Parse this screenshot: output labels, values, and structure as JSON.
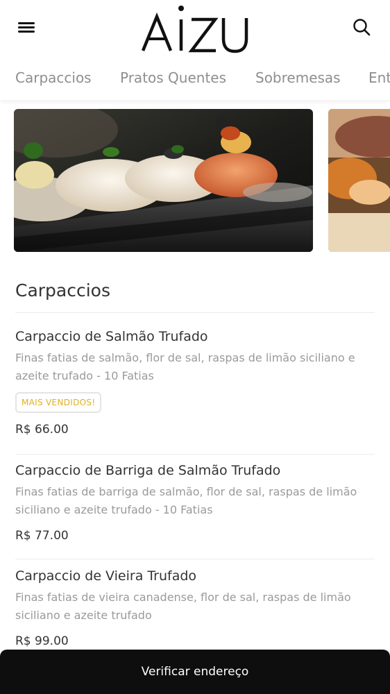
{
  "header": {
    "brand": "AIZU",
    "menu_icon": "hamburger-menu-icon",
    "search_icon": "search-icon"
  },
  "tabs": [
    {
      "label": "Carpaccios"
    },
    {
      "label": "Pratos Quentes"
    },
    {
      "label": "Sobremesas"
    },
    {
      "label": "Ent"
    }
  ],
  "section": {
    "title": "Carpaccios"
  },
  "items": [
    {
      "name": "Carpaccio de Salmão Trufado",
      "desc_line1": "Finas fatias de salmão, flor de sal, raspas de limão siciliano e",
      "desc_line2": "azeite trufado - 10 Fatias",
      "badge": "MAIS VENDIDOS!",
      "price": "R$ 66.00"
    },
    {
      "name": "Carpaccio de Barriga de Salmão Trufado",
      "desc_line1": "Finas fatias de barriga de salmão, flor de sal, raspas de limão",
      "desc_line2": "siciliano e azeite trufado - 10 Fatias",
      "price": "R$ 77.00"
    },
    {
      "name": "Carpaccio de Vieira Trufado",
      "desc_line1": "Finas fatias de vieira canadense, flor de sal, raspas de limão",
      "desc_line2": "siciliano e azeite trufado",
      "price": "R$ 99.00"
    }
  ],
  "bottom_bar": {
    "label": "Verificar endereço"
  },
  "colors": {
    "badge_text": "#e0b020",
    "bottom_bar_bg": "#0e0e0e",
    "tab_text": "#8e8e8e"
  }
}
